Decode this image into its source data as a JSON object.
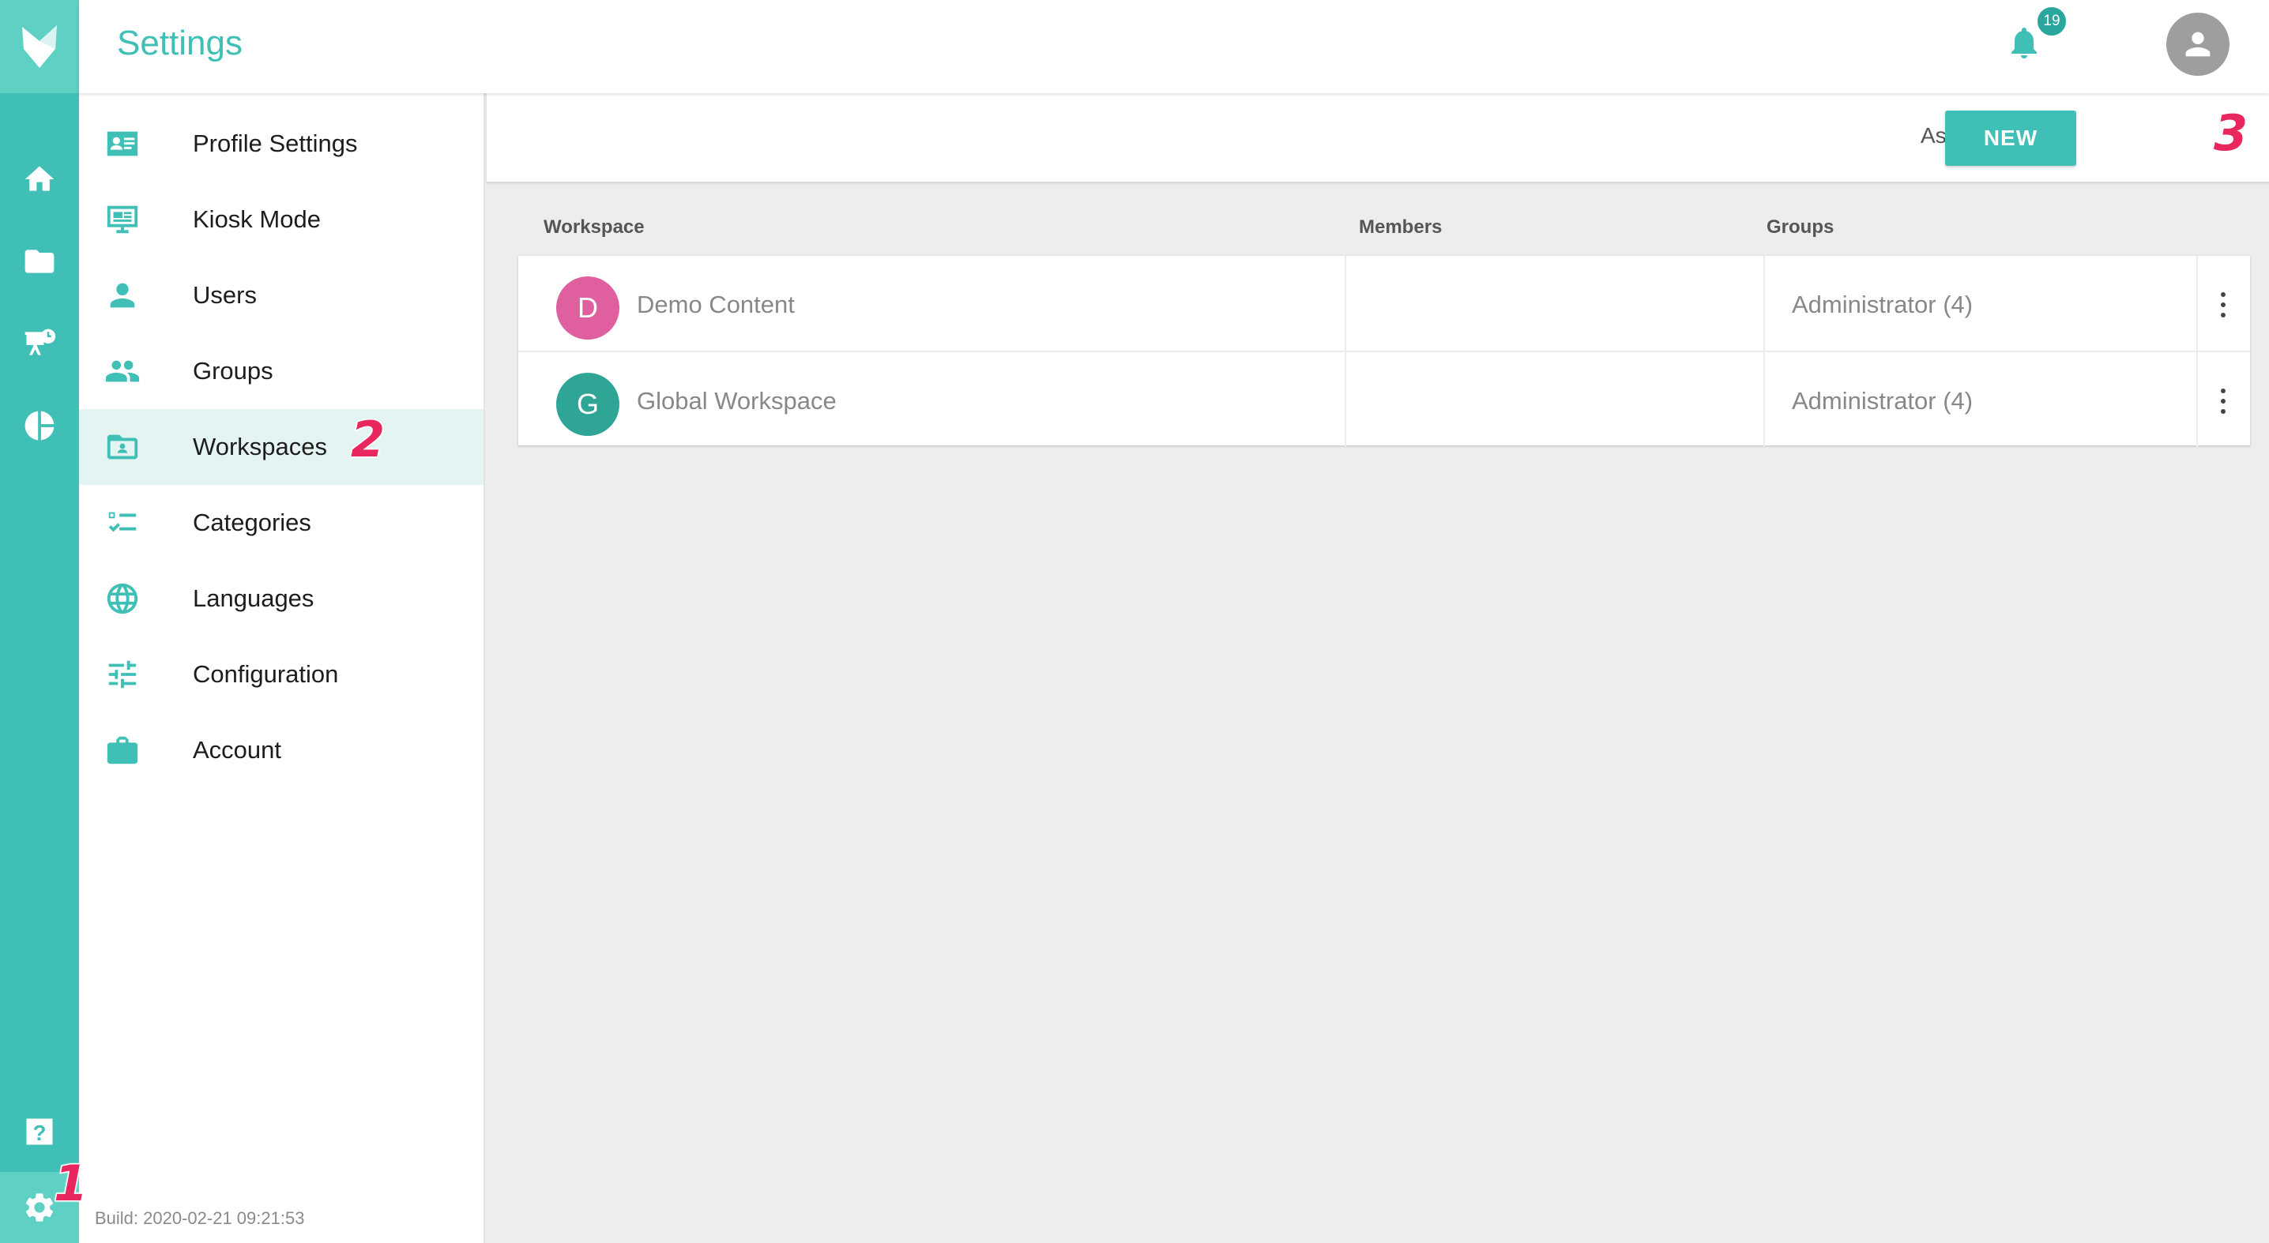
{
  "header": {
    "title": "Settings",
    "notification_count": "19"
  },
  "nav": {
    "items": [
      {
        "label": "Profile Settings",
        "icon": "profile-card-icon"
      },
      {
        "label": "Kiosk Mode",
        "icon": "monitor-icon"
      },
      {
        "label": "Users",
        "icon": "user-icon"
      },
      {
        "label": "Groups",
        "icon": "group-icon"
      },
      {
        "label": "Workspaces",
        "icon": "workspace-folder-icon",
        "active": true
      },
      {
        "label": "Categories",
        "icon": "checklist-icon"
      },
      {
        "label": "Languages",
        "icon": "globe-icon"
      },
      {
        "label": "Configuration",
        "icon": "sliders-icon"
      },
      {
        "label": "Account",
        "icon": "briefcase-icon"
      }
    ],
    "build": "Build: 2020-02-21 09:21:53"
  },
  "rail": {
    "icons": [
      "logo-icon",
      "home-icon",
      "folder-icon",
      "presentation-icon",
      "pie-chart-icon",
      "help-icon",
      "gear-icon"
    ]
  },
  "toolbar": {
    "sort_label": "Ascending",
    "new_label": "NEW"
  },
  "table": {
    "columns": [
      "Workspace",
      "Members",
      "Groups"
    ],
    "rows": [
      {
        "initial": "D",
        "name": "Demo Content",
        "members": "",
        "groups": "Administrator (4)",
        "color": "#e0609f"
      },
      {
        "initial": "G",
        "name": "Global Workspace",
        "members": "",
        "groups": "Administrator (4)",
        "color": "#2fa596"
      }
    ]
  },
  "annotations": [
    "1",
    "2",
    "3"
  ],
  "colors": {
    "accent": "#3fbfb5",
    "accent_light": "#5fd0c4",
    "annotation": "#e8275f"
  }
}
